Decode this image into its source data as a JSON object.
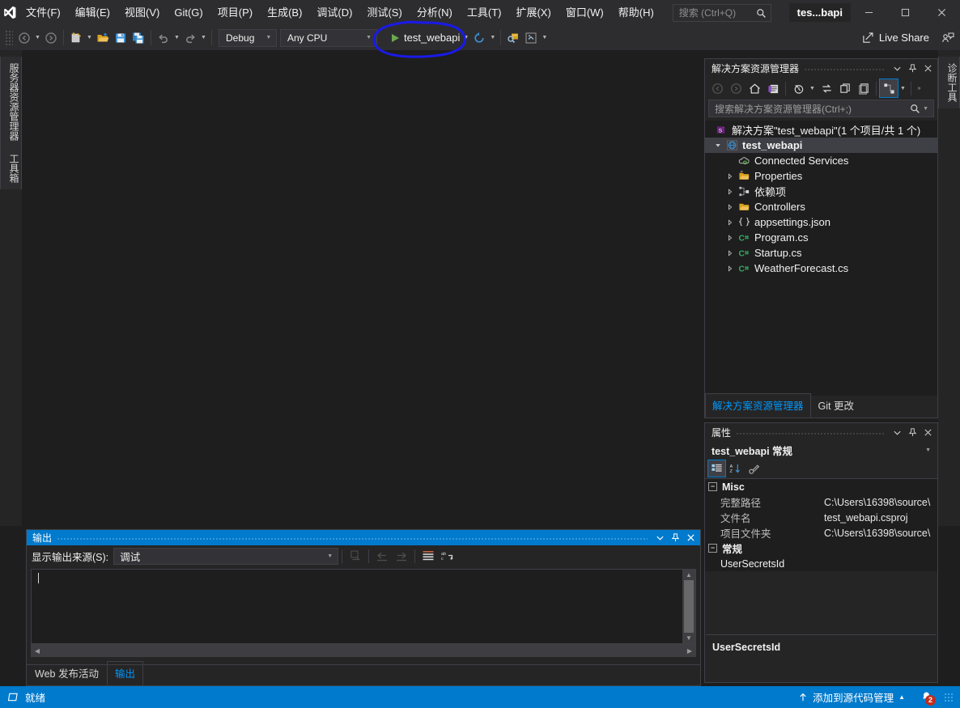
{
  "window": {
    "title": "tes...bapi",
    "minimize_label": "minimize",
    "maximize_label": "maximize",
    "close_label": "close"
  },
  "menu": {
    "items": [
      {
        "label": "文件(F)"
      },
      {
        "label": "编辑(E)"
      },
      {
        "label": "视图(V)"
      },
      {
        "label": "Git(G)"
      },
      {
        "label": "项目(P)"
      },
      {
        "label": "生成(B)"
      },
      {
        "label": "调试(D)"
      },
      {
        "label": "测试(S)"
      },
      {
        "label": "分析(N)"
      },
      {
        "label": "工具(T)"
      },
      {
        "label": "扩展(X)"
      },
      {
        "label": "窗口(W)"
      },
      {
        "label": "帮助(H)"
      }
    ],
    "search_placeholder": "搜索 (Ctrl+Q)"
  },
  "toolbar": {
    "configuration": "Debug",
    "platform": "Any CPU",
    "run_target": "test_webapi",
    "live_share": "Live Share",
    "icons": [
      "navigate-back-icon",
      "navigate-forward-icon",
      "new-project-icon",
      "open-file-icon",
      "save-icon",
      "save-all-icon",
      "undo-icon",
      "redo-icon",
      "refresh-icon",
      "attach-process-icon",
      "screenshot-icon"
    ]
  },
  "left_tabs": [
    {
      "label": "服务器资源管理器"
    },
    {
      "label": "工具箱"
    }
  ],
  "right_tabs": [
    {
      "label": "诊断工具"
    }
  ],
  "solution_explorer": {
    "title": "解决方案资源管理器",
    "search_placeholder": "搜索解决方案资源管理器(Ctrl+;)",
    "tree": [
      {
        "label": "解决方案\"test_webapi\"(1 个项目/共 1 个)",
        "icon": "solution-icon",
        "indent": 0,
        "expander": "none",
        "selected": false,
        "bold": false
      },
      {
        "label": "test_webapi",
        "icon": "web-project-icon",
        "indent": 1,
        "expander": "expanded",
        "selected": true,
        "bold": true
      },
      {
        "label": "Connected Services",
        "icon": "connected-services-icon",
        "indent": 2,
        "expander": "none",
        "selected": false,
        "bold": false
      },
      {
        "label": "Properties",
        "icon": "properties-folder-icon",
        "indent": 2,
        "expander": "collapsed",
        "selected": false,
        "bold": false
      },
      {
        "label": "依赖项",
        "icon": "dependencies-icon",
        "indent": 2,
        "expander": "collapsed",
        "selected": false,
        "bold": false
      },
      {
        "label": "Controllers",
        "icon": "folder-icon",
        "indent": 2,
        "expander": "collapsed",
        "selected": false,
        "bold": false
      },
      {
        "label": "appsettings.json",
        "icon": "json-file-icon",
        "indent": 2,
        "expander": "collapsed",
        "selected": false,
        "bold": false
      },
      {
        "label": "Program.cs",
        "icon": "csharp-file-icon",
        "indent": 2,
        "expander": "collapsed",
        "selected": false,
        "bold": false
      },
      {
        "label": "Startup.cs",
        "icon": "csharp-file-icon",
        "indent": 2,
        "expander": "collapsed",
        "selected": false,
        "bold": false
      },
      {
        "label": "WeatherForecast.cs",
        "icon": "csharp-file-icon",
        "indent": 2,
        "expander": "collapsed",
        "selected": false,
        "bold": false
      }
    ],
    "tabs": [
      {
        "label": "解决方案资源管理器",
        "active": true
      },
      {
        "label": "Git 更改",
        "active": false
      }
    ]
  },
  "properties": {
    "title": "属性",
    "object_name": "test_webapi 常规",
    "categories": [
      {
        "name": "Misc",
        "rows": [
          {
            "name": "完整路径",
            "value": "C:\\Users\\16398\\source\\"
          },
          {
            "name": "文件名",
            "value": "test_webapi.csproj"
          },
          {
            "name": "项目文件夹",
            "value": "C:\\Users\\16398\\source\\"
          }
        ]
      },
      {
        "name": "常规",
        "rows": [
          {
            "name": "UserSecretsId",
            "value": ""
          }
        ]
      }
    ],
    "description_title": "UserSecretsId",
    "description_text": ""
  },
  "output": {
    "title": "输出",
    "source_label": "显示输出来源(S):",
    "source_value": "调试",
    "content": "",
    "tabs": [
      {
        "label": "Web 发布活动",
        "active": false
      },
      {
        "label": "输出",
        "active": true
      }
    ],
    "icons": [
      "clear-output-icon",
      "navigate-previous-icon",
      "navigate-next-icon",
      "toggle-wordwrap-icon",
      "find-icon"
    ]
  },
  "status_bar": {
    "state": "就绪",
    "source_control": "添加到源代码管理",
    "notification_count": "2"
  },
  "colors": {
    "accent": "#007acc",
    "annotation": "#1a1ae6",
    "run_green": "#6aa84f",
    "link_blue": "#0097fb",
    "badge_red": "#c42b1c"
  },
  "annotation": {
    "shape": "hand-drawn-ellipse",
    "target": "run-button"
  }
}
